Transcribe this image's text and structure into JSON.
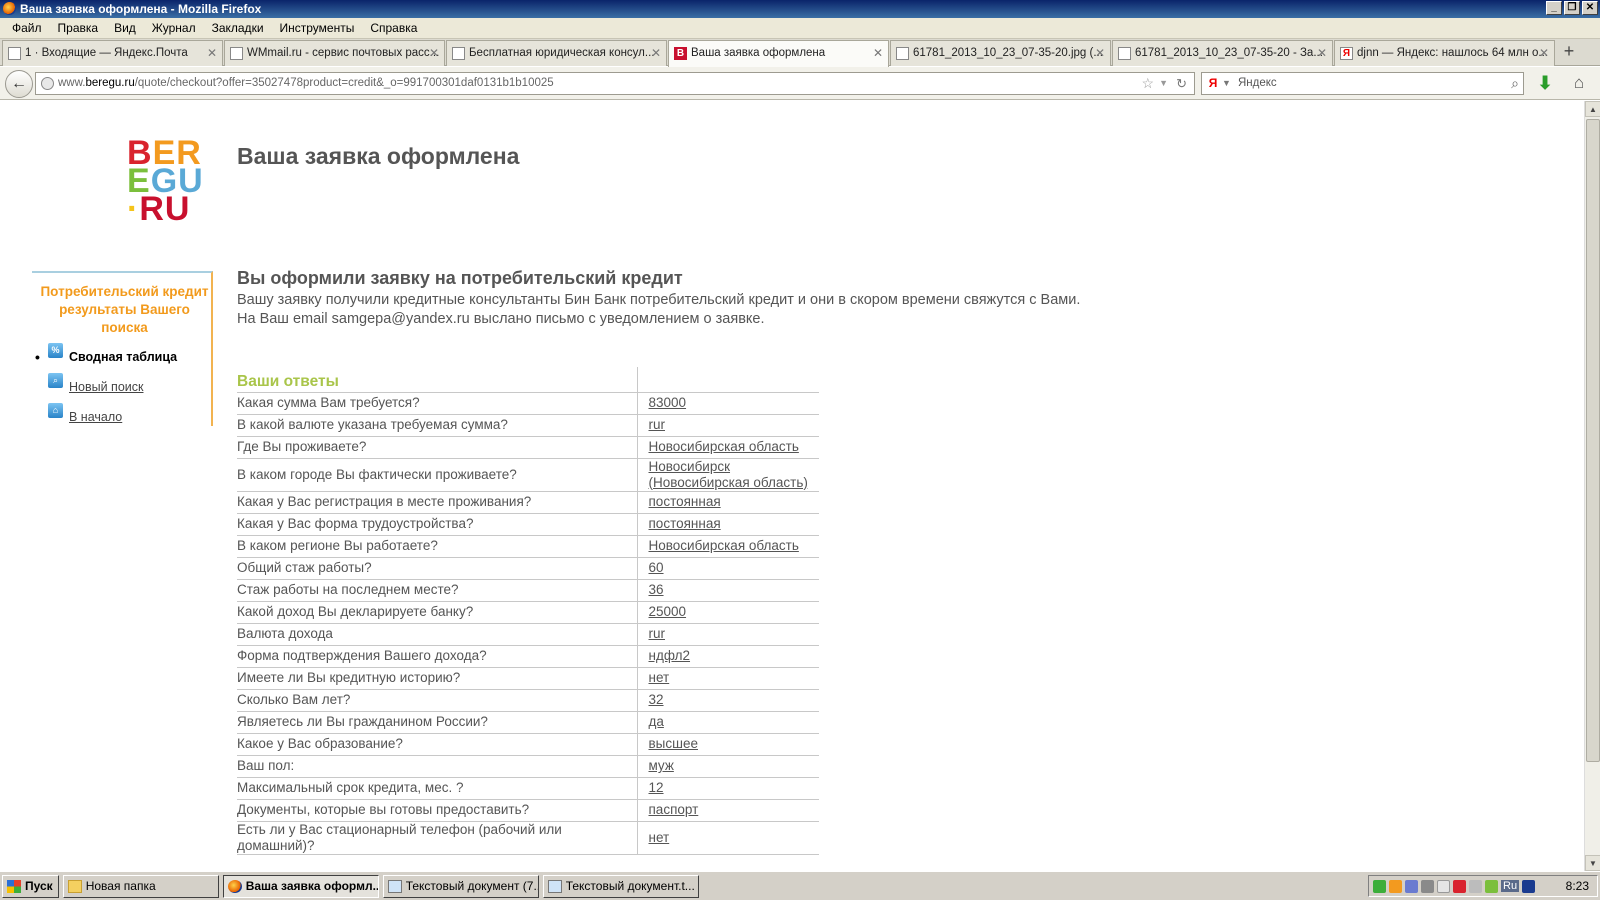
{
  "window": {
    "title": "Ваша заявка оформлена - Mozilla Firefox",
    "buttons": [
      "_",
      "❐",
      "✕"
    ]
  },
  "menu": [
    "Файл",
    "Правка",
    "Вид",
    "Журнал",
    "Закладки",
    "Инструменты",
    "Справка"
  ],
  "tabs": [
    {
      "label": "1 · Входящие — Яндекс.Почта",
      "active": false
    },
    {
      "label": "WMmail.ru - сервис почтовых расс...",
      "active": false
    },
    {
      "label": "Бесплатная юридическая консул...",
      "active": false
    },
    {
      "label": "Ваша заявка оформлена",
      "active": true
    },
    {
      "label": "61781_2013_10_23_07-35-20.jpg (...",
      "active": false
    },
    {
      "label": "61781_2013_10_23_07-35-20 - За...",
      "active": false
    },
    {
      "label": "djnn — Яндекс: нашлось 64 млн о...",
      "active": false
    }
  ],
  "nav": {
    "url_prefix": "www.",
    "url_host": "beregu.ru",
    "url_path": "/quote/checkout?offer=35027478product=credit&_o=991700301daf0131b1b10025",
    "search_placeholder": "Яндекс"
  },
  "logo": {
    "r1": [
      "B",
      "E",
      "R"
    ],
    "r2": [
      "E",
      "G",
      "U"
    ],
    "r3": [
      "·",
      "R",
      "U"
    ]
  },
  "page": {
    "title": "Ваша заявка оформлена",
    "heading": "Вы оформили заявку на потребительский кредит",
    "message_line1": "Вашу заявку получили кредитные консультанты Бин Банк потребительский кредит и они в скором времени свяжутся с Вами.",
    "message_line2": "На Ваш email samgepa@yandex.ru выслано письмо с уведомлением о заявке."
  },
  "sidebar": {
    "title": "Потребительский кредит результаты Вашего поиска",
    "items": [
      {
        "label": "Сводная таблица",
        "icon": "%",
        "current": true
      },
      {
        "label": "Новый поиск",
        "icon": "search-icon",
        "current": false
      },
      {
        "label": "В начало",
        "icon": "home-icon",
        "current": false
      }
    ]
  },
  "answers": {
    "header": "Ваши ответы",
    "rows": [
      {
        "q": "Какая сумма Вам требуется?",
        "a": "83000"
      },
      {
        "q": "В какой валюте указана требуемая сумма?",
        "a": "rur"
      },
      {
        "q": "Где Вы проживаете?",
        "a": "Новосибирская область"
      },
      {
        "q": "В каком городе Вы фактически проживаете?",
        "a": "Новосибирск (Новосибирская область)"
      },
      {
        "q": "Какая у Вас регистрация в месте проживания?",
        "a": "постоянная"
      },
      {
        "q": "Какая у Вас форма трудоустройства?",
        "a": "постоянная"
      },
      {
        "q": "В каком регионе Вы работаете?",
        "a": "Новосибирская область"
      },
      {
        "q": "Общий стаж работы?",
        "a": "60"
      },
      {
        "q": "Стаж работы на последнем месте?",
        "a": "36"
      },
      {
        "q": "Какой доход Вы декларируете банку?",
        "a": "25000"
      },
      {
        "q": "Валюта дохода",
        "a": "rur"
      },
      {
        "q": "Форма подтверждения Вашего дохода?",
        "a": "ндфл2"
      },
      {
        "q": "Имеете ли Вы кредитную историю?",
        "a": "нет"
      },
      {
        "q": "Сколько Вам лет?",
        "a": "32"
      },
      {
        "q": "Являетесь ли Вы гражданином России?",
        "a": "да"
      },
      {
        "q": "Какое у Вас образование?",
        "a": "высшее"
      },
      {
        "q": "Ваш пол:",
        "a": "муж"
      },
      {
        "q": "Максимальный срок кредита, мес. ?",
        "a": "12"
      },
      {
        "q": "Документы, которые вы готовы предоставить?",
        "a": "паспорт"
      },
      {
        "q": "Есть ли у Вас стационарный телефон (рабочий или домашний)?",
        "a": "нет"
      }
    ]
  },
  "taskbar": {
    "start": "Пуск",
    "buttons": [
      {
        "label": "Новая папка",
        "active": false
      },
      {
        "label": "Ваша заявка оформл...",
        "active": true
      },
      {
        "label": "Текстовый документ (7...",
        "active": false
      },
      {
        "label": "Текстовый документ.t...",
        "active": false
      }
    ],
    "tray_lang": "Ru",
    "clock": "8:23"
  },
  "colors": {
    "accent_orange": "#f29a1c",
    "answers_header": "#a9c54a",
    "title_gray": "#555555"
  }
}
